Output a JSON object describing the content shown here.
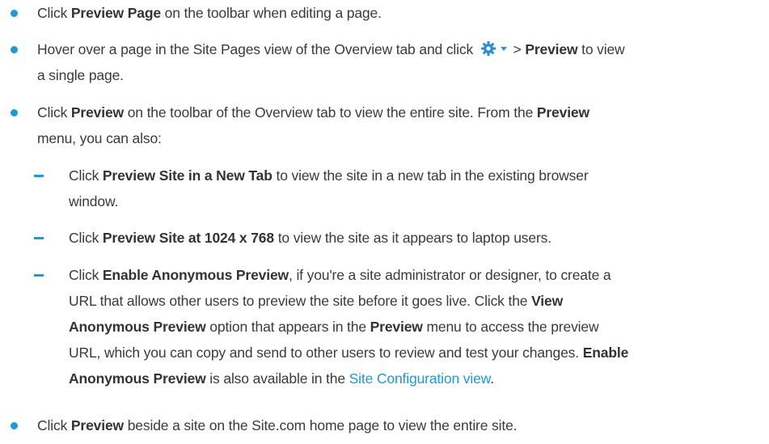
{
  "bullet1": {
    "pre": "Click ",
    "b1": "Preview Page",
    "post": " on the toolbar when editing a page."
  },
  "bullet2": {
    "pre": "Hover over a page in the Site Pages view of the Overview tab and click ",
    "gt": " > ",
    "b1": "Preview",
    "post": " to view",
    "line2": "a single page."
  },
  "bullet3": {
    "pre": "Click ",
    "b1": "Preview",
    "mid": " on the toolbar of the Overview tab to view the entire site. From the ",
    "b2": "Preview",
    "line2": "menu, you can also:"
  },
  "sub1": {
    "pre": "Click ",
    "b1": "Preview Site in a New Tab",
    "post": " to view the site in a new tab in the existing browser",
    "line2": "window."
  },
  "sub2": {
    "pre": "Click ",
    "b1": "Preview Site at 1024 x 768",
    "post": " to view the site as it appears to laptop users."
  },
  "sub3": {
    "pre": "Click ",
    "b1": "Enable Anonymous Preview",
    "post": ", if you're a site administrator or designer, to create a",
    "l2pre": "URL that allows other users to preview the site before it goes live. Click the ",
    "l2b": "View",
    "l3b1": "Anonymous Preview",
    "l3mid": " option that appears in the ",
    "l3b2": "Preview",
    "l3post": " menu to access the preview",
    "l4pre": "URL, which you can copy and send to other users to review and test your changes. ",
    "l4b": "Enable",
    "l5b": "Anonymous Preview",
    "l5mid": " is also available in the ",
    "l5link": "Site Configuration view",
    "l5post": "."
  },
  "bullet4": {
    "pre": "Click ",
    "b1": "Preview",
    "post": " beside a site on the Site.com home page to view the entire site."
  },
  "colors": {
    "accent": "#1a9ad6",
    "text": "#3a3a3a"
  },
  "icons": {
    "gear": "gear-icon",
    "dropdown": "chevron-down-icon"
  }
}
